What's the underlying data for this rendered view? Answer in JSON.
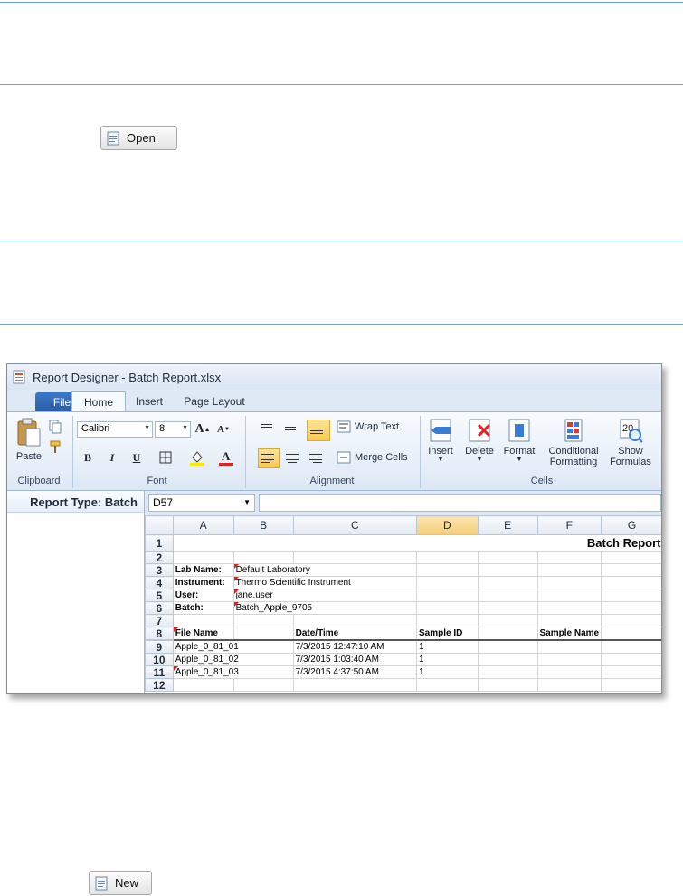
{
  "doc": {
    "open_button": "Open",
    "new_button": "New"
  },
  "window": {
    "title": "Report Designer - Batch Report.xlsx",
    "tabs": {
      "file": "File",
      "home": "Home",
      "insert": "Insert",
      "page_layout": "Page Layout"
    },
    "ribbon": {
      "clipboard": {
        "paste": "Paste",
        "group": "Clipboard"
      },
      "font": {
        "name": "Calibri",
        "size": "8",
        "group": "Font",
        "bold": "B",
        "italic": "I",
        "underline": "U",
        "grow": "A",
        "shrink": "A"
      },
      "alignment": {
        "wrap_text": "Wrap Text",
        "merge_cells": "Merge Cells",
        "group": "Alignment"
      },
      "cells": {
        "insert": "Insert",
        "delete": "Delete",
        "format": "Format",
        "conditional_formatting": "Conditional Formatting",
        "show_formulas": "Show Formulas",
        "group": "Cells"
      }
    },
    "left_panel_header": "Report Type: Batch",
    "name_box": "D57",
    "columns": [
      "A",
      "B",
      "C",
      "D",
      "E",
      "F",
      "G"
    ],
    "rows": [
      {
        "n": "1",
        "cells": [
          "",
          "",
          "",
          "",
          "",
          "",
          ""
        ],
        "title": "Batch Report"
      },
      {
        "n": "2",
        "cells": [
          "",
          "",
          "",
          "",
          "",
          "",
          ""
        ]
      },
      {
        "n": "3",
        "cells": [
          "Lab Name:",
          "Default Laboratory",
          "",
          "",
          "",
          "",
          ""
        ]
      },
      {
        "n": "4",
        "cells": [
          "Instrument:",
          "Thermo Scientific Instrument",
          "",
          "",
          "",
          "",
          ""
        ]
      },
      {
        "n": "5",
        "cells": [
          "User:",
          "jane.user",
          "",
          "",
          "",
          "",
          ""
        ]
      },
      {
        "n": "6",
        "cells": [
          "Batch:",
          "Batch_Apple_9705",
          "",
          "",
          "",
          "",
          ""
        ]
      },
      {
        "n": "7",
        "cells": [
          "",
          "",
          "",
          "",
          "",
          "",
          ""
        ]
      },
      {
        "n": "8",
        "cells": [
          "File Name",
          "",
          "Date/Time",
          "Sample ID",
          "",
          "Sample Name",
          ""
        ]
      },
      {
        "n": "9",
        "cells": [
          "Apple_0_81_01",
          "",
          "7/3/2015 12:47:10 AM",
          "1",
          "",
          "",
          ""
        ]
      },
      {
        "n": "10",
        "cells": [
          "Apple_0_81_02",
          "",
          "7/3/2015 1:03:40 AM",
          "1",
          "",
          "",
          ""
        ]
      },
      {
        "n": "11",
        "cells": [
          "Apple_0_81_03",
          "",
          "7/3/2015 4:37:50 AM",
          "1",
          "",
          "",
          ""
        ]
      },
      {
        "n": "12",
        "cells": [
          "",
          "",
          "",
          "",
          "",
          "",
          ""
        ]
      }
    ]
  }
}
